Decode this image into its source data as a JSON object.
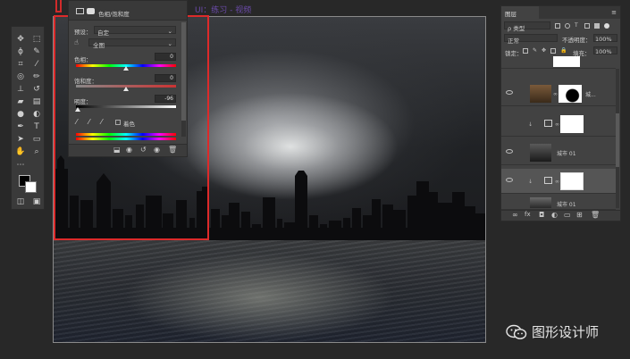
{
  "credit_text": "UI：练习 - 视频",
  "properties_panel": {
    "title": "色相/饱和度",
    "preset_label": "预设：",
    "preset_value": "自定",
    "channel_value": "全图",
    "hue_label": "色相：",
    "hue_value": "0",
    "saturation_label": "饱和度：",
    "saturation_value": "0",
    "lightness_label": "明度：",
    "lightness_value": "-96",
    "colorize_label": "着色",
    "hue_level": 0.5,
    "saturation_level": 0.5,
    "lightness_level": 0.02
  },
  "layers_panel": {
    "tab_label": "图层",
    "filter_label": "ρ 类型",
    "blend_mode": "正常",
    "opacity_label": "不透明度：",
    "opacity_value": "100%",
    "lock_label": "锁定：",
    "fill_label": "填充：",
    "fill_value": "100%",
    "layers": [
      {
        "name": "城..."
      },
      {
        "name": ""
      },
      {
        "name": "城市 01"
      },
      {
        "name": ""
      },
      {
        "name": "城市 01"
      }
    ]
  },
  "watermark": {
    "text": "图形设计师",
    "icon": "wechat-icon"
  },
  "colors": {
    "highlight": "#dd2a2a",
    "panel_bg": "#424242",
    "app_bg": "#282828"
  }
}
